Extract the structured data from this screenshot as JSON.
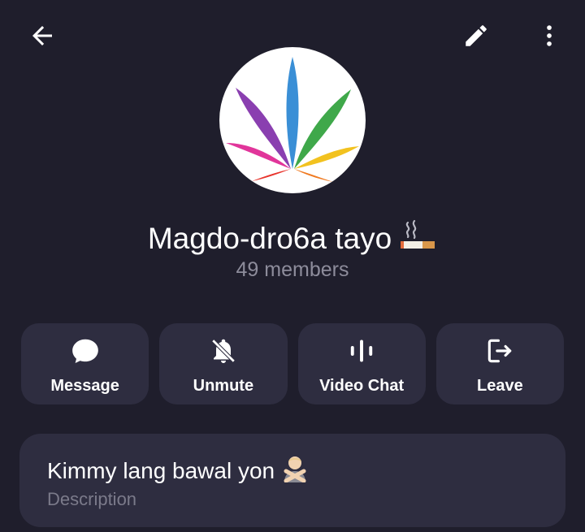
{
  "header": {
    "back_icon": "arrow-left-icon",
    "edit_icon": "pencil-icon",
    "more_icon": "more-vertical-icon"
  },
  "group": {
    "avatar_icon": "rainbow-leaf-icon",
    "name": "Magdo-dro6a tayo",
    "name_emoji": "cigarette-emoji",
    "members": "49 members"
  },
  "actions": [
    {
      "label": "Message",
      "icon": "chat-bubble-icon"
    },
    {
      "label": "Unmute",
      "icon": "bell-off-icon"
    },
    {
      "label": "Video Chat",
      "icon": "sound-bars-icon"
    },
    {
      "label": "Leave",
      "icon": "logout-icon"
    }
  ],
  "info": {
    "description": "Kimmy lang bawal yon",
    "description_emoji": "person-gesturing-no-emoji",
    "description_label": "Description"
  },
  "colors": {
    "background": "#1f1e2c",
    "card": "#2e2d40",
    "muted_text": "#8d8c9b"
  }
}
